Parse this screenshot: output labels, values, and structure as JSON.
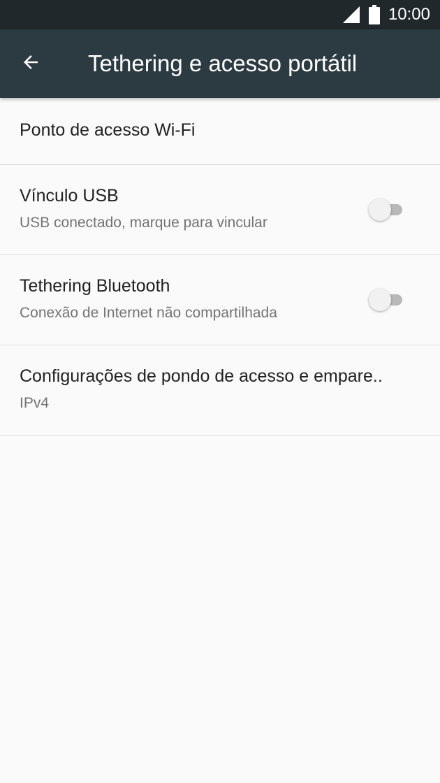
{
  "status_bar": {
    "time": "10:00",
    "icons": [
      "signal-icon",
      "battery-icon"
    ]
  },
  "app_bar": {
    "back_icon": "arrow-back-icon",
    "title": "Tethering e acesso portátil"
  },
  "items": [
    {
      "title": "Ponto de acesso Wi-Fi"
    },
    {
      "title": "Vínculo USB",
      "subtitle": "USB conectado, marque para vincular",
      "toggle_on": false
    },
    {
      "title": "Tethering Bluetooth",
      "subtitle": "Conexão de Internet não compartilhada",
      "toggle_on": false
    },
    {
      "title": "Configurações de pondo de acesso e empare..",
      "subtitle": "IPv4"
    }
  ],
  "colors": {
    "status_bar": "#20282c",
    "app_bar": "#2c3a41",
    "background": "#fafafa",
    "divider": "#dcdcdc",
    "primary_text": "#212121",
    "secondary_text": "#737373",
    "switch_track_off": "#b9b9b9",
    "switch_thumb_off": "#f1f1f1"
  }
}
